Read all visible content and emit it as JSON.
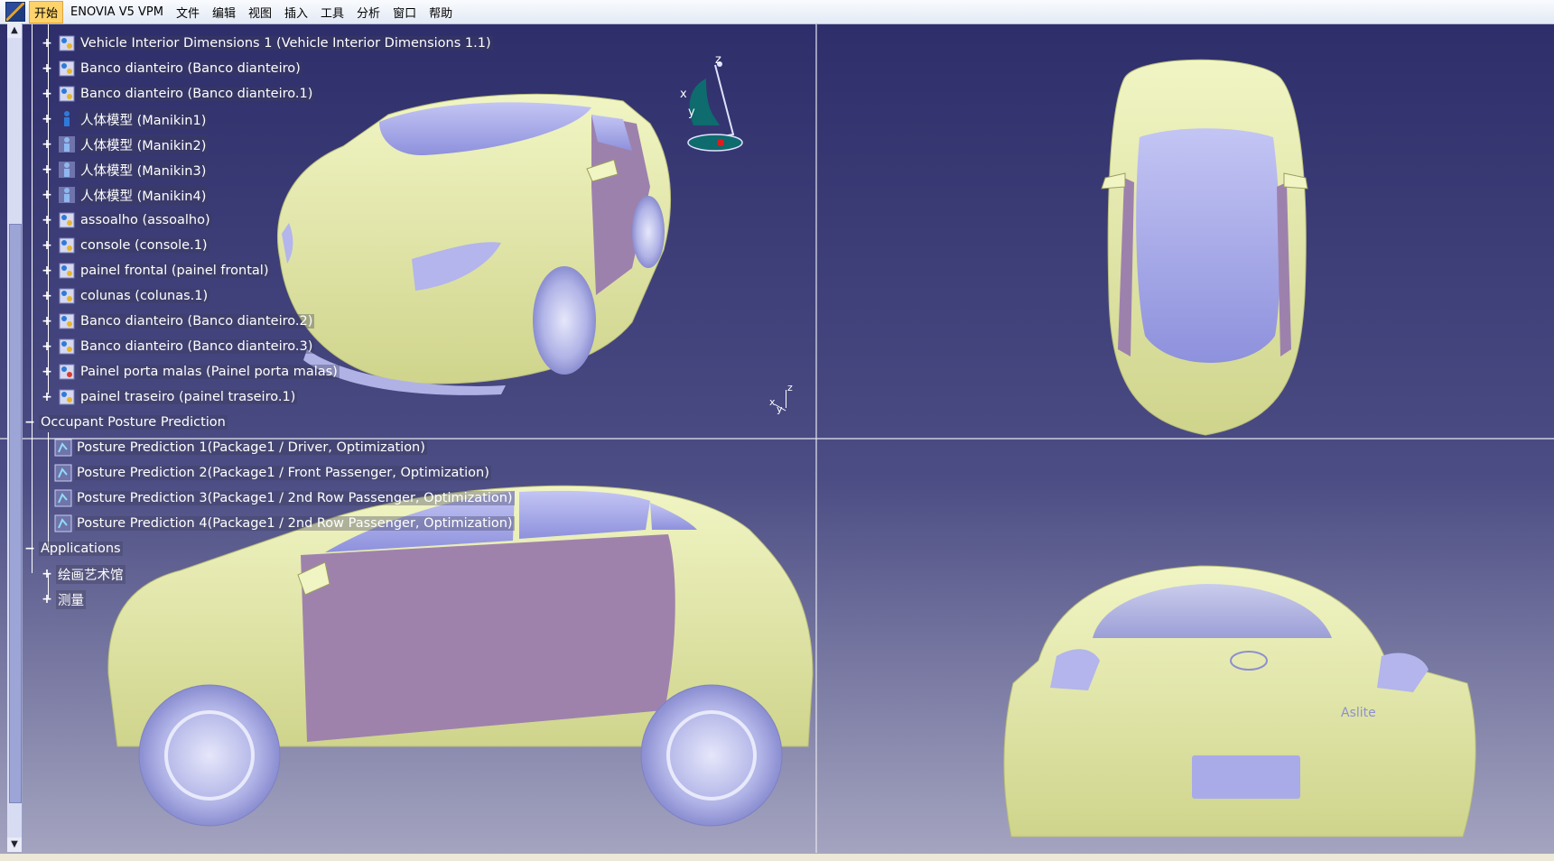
{
  "menubar": {
    "items": [
      "开始",
      "ENOVIA V5 VPM",
      "文件",
      "编辑",
      "视图",
      "插入",
      "工具",
      "分析",
      "窗口",
      "帮助"
    ]
  },
  "tree": {
    "products": [
      "Vehicle Interior Dimensions 1 (Vehicle Interior Dimensions 1.1)",
      "Banco dianteiro (Banco dianteiro)",
      "Banco dianteiro (Banco dianteiro.1)",
      "人体模型 (Manikin1)",
      "人体模型 (Manikin2)",
      "人体模型 (Manikin3)",
      "人体模型 (Manikin4)",
      "assoalho (assoalho)",
      "console (console.1)",
      "painel frontal (painel frontal)",
      "colunas (colunas.1)",
      "Banco dianteiro (Banco dianteiro.2)",
      "Banco dianteiro (Banco dianteiro.3)",
      "Painel porta malas (Painel porta malas)",
      "painel traseiro (painel traseiro.1)"
    ],
    "posture_root": "Occupant Posture Prediction",
    "posture_items": [
      "Posture Prediction 1(Package1 / Driver, Optimization)",
      "Posture Prediction 2(Package1 / Front Passenger, Optimization)",
      "Posture Prediction 3(Package1 / 2nd Row Passenger, Optimization)",
      "Posture Prediction 4(Package1 / 2nd Row Passenger, Optimization)"
    ],
    "applications_root": "Applications",
    "application_items": [
      "绘画艺术馆",
      "测量"
    ]
  },
  "compass": {
    "x": "x",
    "y": "y",
    "z": "z"
  },
  "mini_axis": {
    "x": "x",
    "y": "y",
    "z": "z"
  },
  "rear_badge": "Aslite",
  "colors": {
    "background_top": "#2f2f6a",
    "background_bottom": "#9c9cba",
    "body": "#e7ecae",
    "glass": "#a7a9e8",
    "door": "#9a7faa",
    "tire": "#b2b4e6"
  }
}
